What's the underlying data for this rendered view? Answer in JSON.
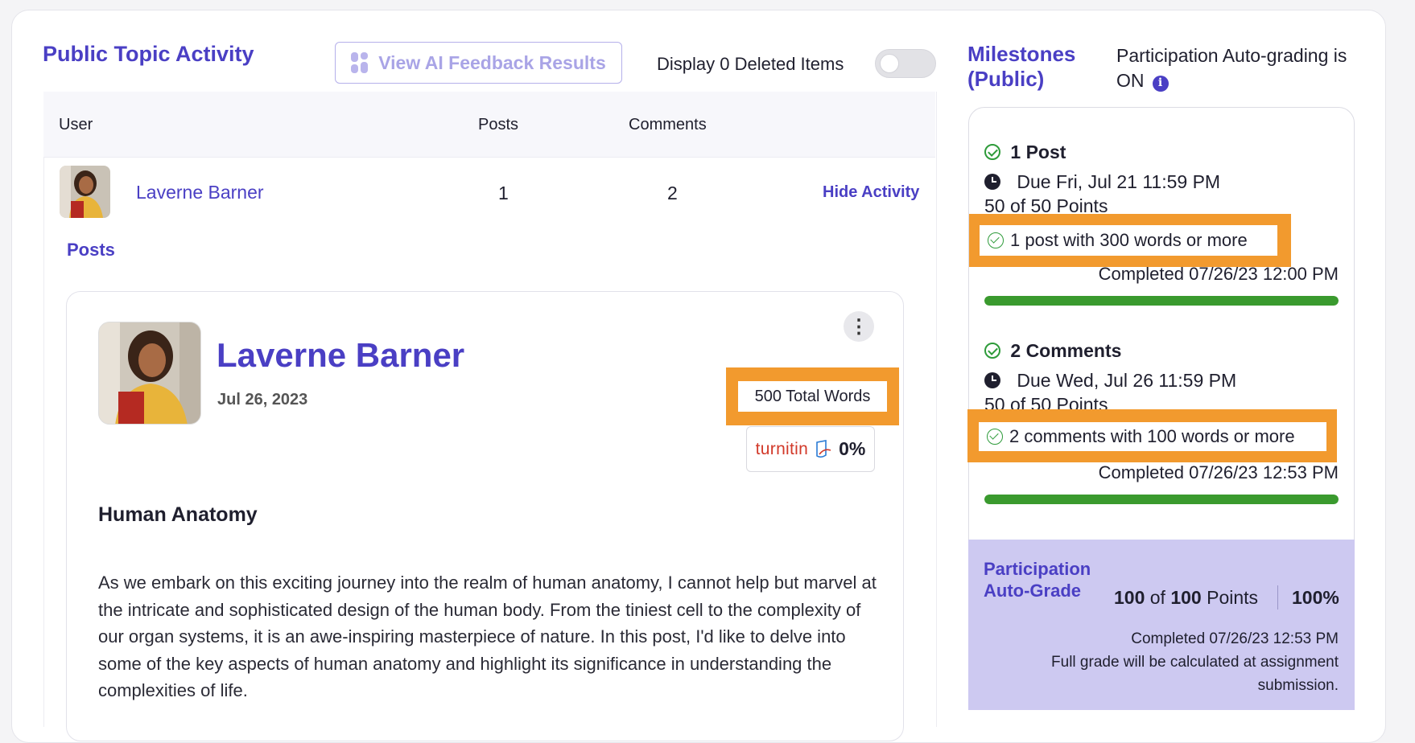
{
  "header": {
    "title": "Public Topic Activity",
    "ai_button_label": "View AI Feedback Results",
    "deleted_label": "Display 0 Deleted Items",
    "deleted_toggle_on": false
  },
  "table": {
    "columns": [
      "User",
      "Posts",
      "Comments"
    ],
    "rows": [
      {
        "user": "Laverne Barner",
        "posts": "1",
        "comments": "2",
        "action": "Hide Activity"
      }
    ]
  },
  "posts_section": {
    "label": "Posts"
  },
  "post": {
    "author": "Laverne Barner",
    "date": "Jul 26, 2023",
    "total_words": "500 Total Words",
    "turnitin_logo": "turnitin",
    "turnitin_score": "0%",
    "title": "Human Anatomy",
    "body": "As we embark on this exciting journey into the realm of human anatomy, I cannot help but marvel at the intricate and sophisticated design of the human body. From the tiniest cell to the complexity of our organ systems, it is an awe-inspiring masterpiece of nature. In this post, I'd like to delve into some of the key aspects of human anatomy and highlight its significance in understanding the complexities of life."
  },
  "milestones": {
    "title": "Milestones (Public)",
    "auto_grading": "Participation Auto-grading is ON",
    "items": [
      {
        "heading": "1 Post",
        "due": "Due Fri, Jul 21 11:59 PM",
        "points": "50 of 50 Points",
        "requirement": "1 post with 300 words or more",
        "completed": "Completed 07/26/23 12:00 PM",
        "progress": 1.0
      },
      {
        "heading": "2 Comments",
        "due": "Due Wed, Jul 26 11:59 PM",
        "points": "50 of 50 Points",
        "requirement": "2 comments with 100 words or more",
        "completed": "Completed 07/26/23 12:53 PM",
        "progress": 1.0
      }
    ],
    "grade": {
      "title_line1": "Participation",
      "title_line2": "Auto-Grade",
      "earned": "100",
      "of_label": "of",
      "total": "100",
      "points_label": "Points",
      "percent": "100%",
      "completed": "Completed 07/26/23 12:53 PM",
      "note": "Full grade will be calculated at assignment submission."
    }
  },
  "colors": {
    "accent": "#4a3fc4",
    "highlight": "#f29a2e",
    "success": "#3a9a2e",
    "grade_bg": "#cdc9f1"
  }
}
